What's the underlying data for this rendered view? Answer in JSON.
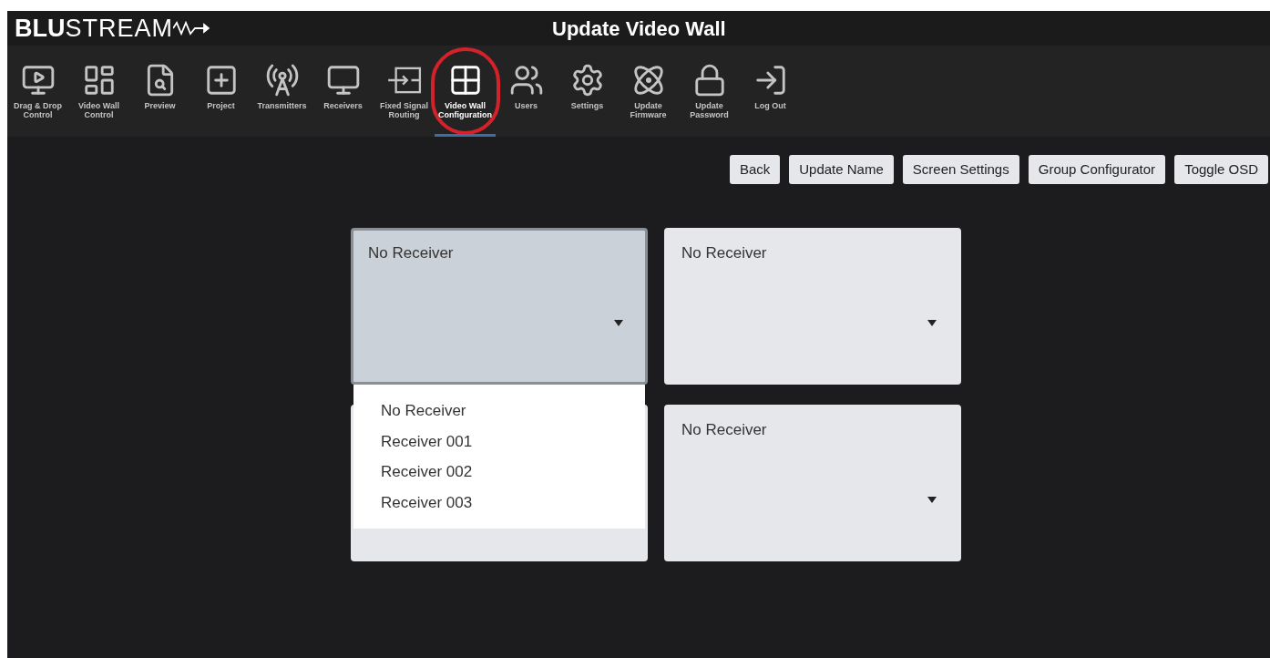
{
  "header": {
    "logo_bold": "BLU",
    "logo_light": "STREAM",
    "title": "Update Video Wall"
  },
  "nav": [
    {
      "label": "Drag & Drop Control",
      "selected": false
    },
    {
      "label": "Video Wall Control",
      "selected": false
    },
    {
      "label": "Preview",
      "selected": false
    },
    {
      "label": "Project",
      "selected": false
    },
    {
      "label": "Transmitters",
      "selected": false
    },
    {
      "label": "Receivers",
      "selected": false
    },
    {
      "label": "Fixed Signal Routing",
      "selected": false
    },
    {
      "label": "Video Wall Configuration",
      "selected": true
    },
    {
      "label": "Users",
      "selected": false
    },
    {
      "label": "Settings",
      "selected": false
    },
    {
      "label": "Update Firmware",
      "selected": false
    },
    {
      "label": "Update Password",
      "selected": false
    },
    {
      "label": "Log Out",
      "selected": false
    }
  ],
  "actions": [
    "Back",
    "Update Name",
    "Screen Settings",
    "Group Configurator",
    "Toggle OSD"
  ],
  "screens": [
    {
      "value": "No Receiver",
      "open": true,
      "options": [
        "No Receiver",
        "Receiver 001",
        "Receiver 002",
        "Receiver 003"
      ]
    },
    {
      "value": "No Receiver",
      "open": false
    },
    {
      "open": false
    },
    {
      "value": "No Receiver",
      "open": false
    }
  ]
}
